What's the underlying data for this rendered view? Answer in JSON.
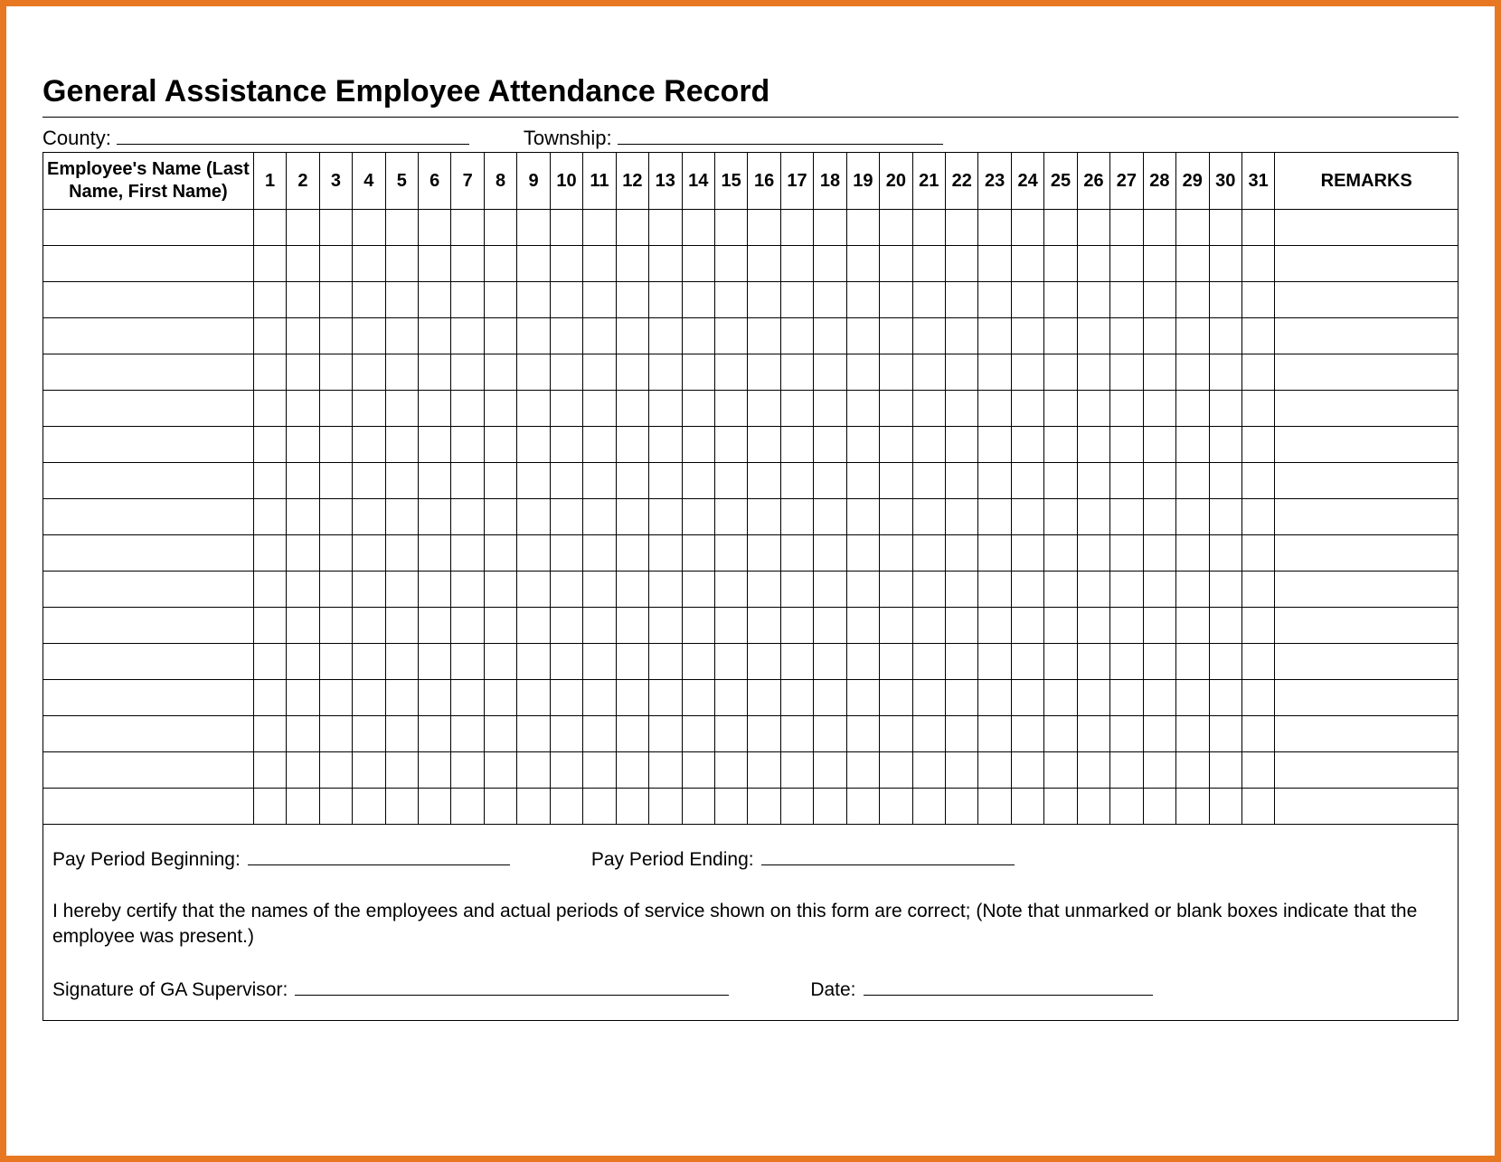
{
  "title": "General Assistance Employee Attendance Record",
  "meta": {
    "county_label": "County:",
    "township_label": "Township:"
  },
  "headers": {
    "name": "Employee's Name (Last Name, First Name)",
    "remarks": "REMARKS"
  },
  "days": [
    "1",
    "2",
    "3",
    "4",
    "5",
    "6",
    "7",
    "8",
    "9",
    "10",
    "11",
    "12",
    "13",
    "14",
    "15",
    "16",
    "17",
    "18",
    "19",
    "20",
    "21",
    "22",
    "23",
    "24",
    "25",
    "26",
    "27",
    "28",
    "29",
    "30",
    "31"
  ],
  "row_count": 17,
  "footer": {
    "pay_begin_label": "Pay Period Beginning:",
    "pay_end_label": "Pay Period Ending:",
    "certification": "I hereby certify that the names of the employees and actual periods of service shown on this form are correct;  (Note that unmarked or blank boxes indicate that the employee was present.)",
    "signature_label": "Signature of GA Supervisor:",
    "date_label": "Date:"
  }
}
